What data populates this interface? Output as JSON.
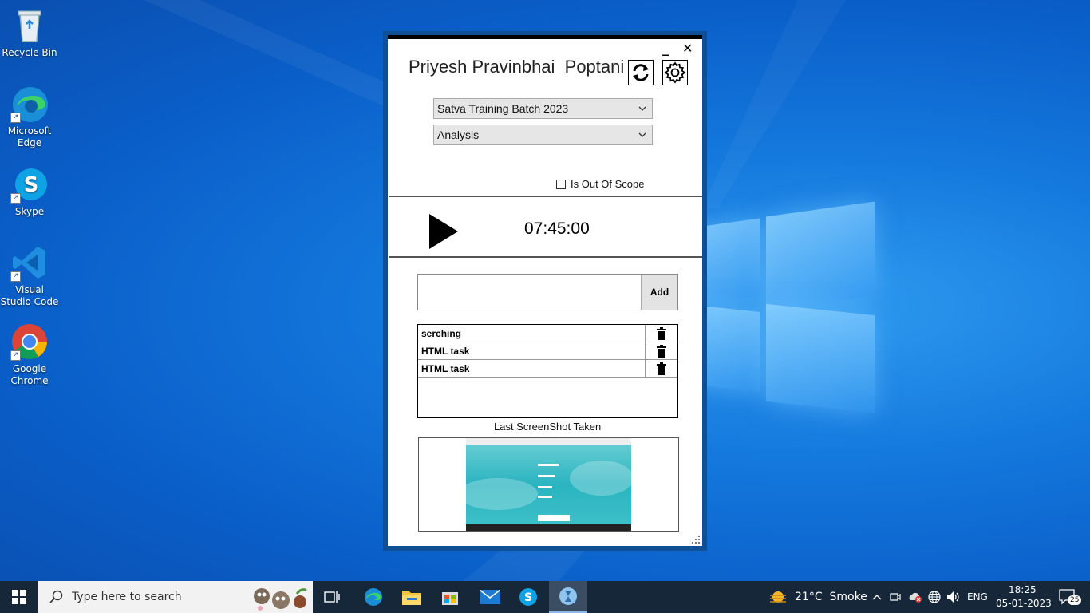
{
  "desktop": {
    "icons": [
      {
        "label": "Recycle Bin",
        "icon": "recycle-bin-icon"
      },
      {
        "label": "Microsoft Edge",
        "icon": "edge-icon"
      },
      {
        "label": "Skype",
        "icon": "skype-icon"
      },
      {
        "label": "Visual Studio Code",
        "icon": "vscode-icon"
      },
      {
        "label": "Google Chrome",
        "icon": "chrome-icon"
      }
    ]
  },
  "app": {
    "user_name": "Priyesh Pravinbhai  Poptani",
    "minimize_label": "_",
    "close_label": "✕",
    "project_select": "Satva Training Batch 2023",
    "task_type_select": "Analysis",
    "out_of_scope_label": "Is Out Of Scope",
    "out_of_scope_checked": false,
    "timer": "07:45:00",
    "task_input_placeholder": "",
    "add_label": "Add",
    "tasks": [
      {
        "name": "serching"
      },
      {
        "name": "HTML task"
      },
      {
        "name": "HTML task"
      }
    ],
    "screenshot_label": "Last ScreenShot Taken"
  },
  "taskbar": {
    "search_placeholder": "Type here to search",
    "weather": "21°C  Smoke",
    "language": "ENG",
    "time": "18:25",
    "date": "05-01-2023",
    "notification_count": "25",
    "colors": {
      "bar": "#16273a",
      "accent": "#0078d7"
    }
  }
}
